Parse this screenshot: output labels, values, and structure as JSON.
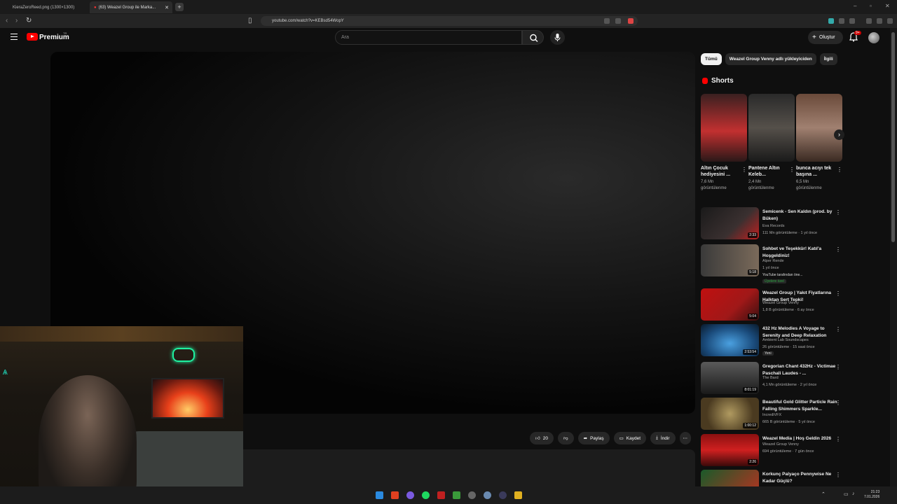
{
  "browser": {
    "tabs": [
      {
        "title": "KieraZeroReed.png (1300×1300)"
      },
      {
        "title": "(63) Weazel Group ile Marka..."
      }
    ],
    "url": "youtube.com/watch?v=KEBsd54WopY"
  },
  "youtube": {
    "logo": "Premium",
    "search_placeholder": "Ara",
    "create_label": "Oluştur",
    "notif_count": "9+",
    "actions": {
      "like_count": "20",
      "share": "Paylaş",
      "save": "Kaydet",
      "download": "İndir"
    },
    "chips": [
      "Tümü",
      "Weazel Group Venny adlı yükleyiciden",
      "İlgili"
    ],
    "shorts_heading": "Shorts",
    "shorts": [
      {
        "title": "Altın Çocuk hediyesini ...",
        "views": "7,6 Mn görüntülenme"
      },
      {
        "title": "Pantene Altın Keleb...",
        "views": "2,4 Mn görüntülenme"
      },
      {
        "title": "bunca acıyı tek başına ...",
        "views": "6,5 Mn görüntülenme"
      }
    ],
    "videos": [
      {
        "title": "Semicenk - Sen Kaldın (prod. by Büken)",
        "channel": "Eva Records",
        "meta": "111 Mn görüntüleme · 1 yıl önce",
        "duration": "2:33",
        "extra": "",
        "tag": ""
      },
      {
        "title": "Sohbet ve Teşekkür! Katıl'a Hoşgeldiniz!",
        "channel": "Alper Rende",
        "meta": "1 yıl önce",
        "duration": "5:18",
        "extra": "YouTube tarafından öne...",
        "tag": "Üyelere özel"
      },
      {
        "title": "Weazel Group | Yakıt Fiyatlarına Halktan Sert Tepki!",
        "channel": "Weazel Group Venny",
        "meta": "1,8 B görüntüleme · 6 ay önce",
        "duration": "5:04",
        "extra": "",
        "tag": ""
      },
      {
        "title": "432 Hz Melodies A Voyage to Serenity and Deep Relaxation",
        "channel": "Ambient Lab Soundscapes",
        "meta": "26 görüntüleme · 15 saat önce",
        "duration": "2:53:54",
        "extra": "Yeni",
        "tag": ""
      },
      {
        "title": "Gregorian Chant 432Hz - Victimae Paschali Laudes - ...",
        "channel": "The Bard",
        "meta": "4,1 Mn görüntüleme · 2 yıl önce",
        "duration": "8:01:19",
        "extra": "",
        "tag": ""
      },
      {
        "title": "Beautiful Gold Glitter Particle Rain Falling Shimmers Sparkle...",
        "channel": "IncrediVFX",
        "meta": "665 B görüntüleme · 5 yıl önce",
        "duration": "1:00:12",
        "extra": "",
        "tag": ""
      },
      {
        "title": "Weazel Media | Hoş Geldin 2026",
        "channel": "Weazel Group Venny",
        "meta": "694 görüntüleme · 7 gün önce",
        "duration": "2:26",
        "extra": "",
        "tag": ""
      },
      {
        "title": "Korkunç Palyaço Pennywise Ne Kadar Güçlü?",
        "channel": "",
        "meta": "",
        "duration": "",
        "extra": "",
        "tag": ""
      }
    ]
  },
  "taskbar": {
    "time": "21:23",
    "date": "7.01.2026"
  },
  "colors": {
    "accent": "#ff0000",
    "background": "#0f0f0f",
    "chip_bg": "#272727"
  }
}
